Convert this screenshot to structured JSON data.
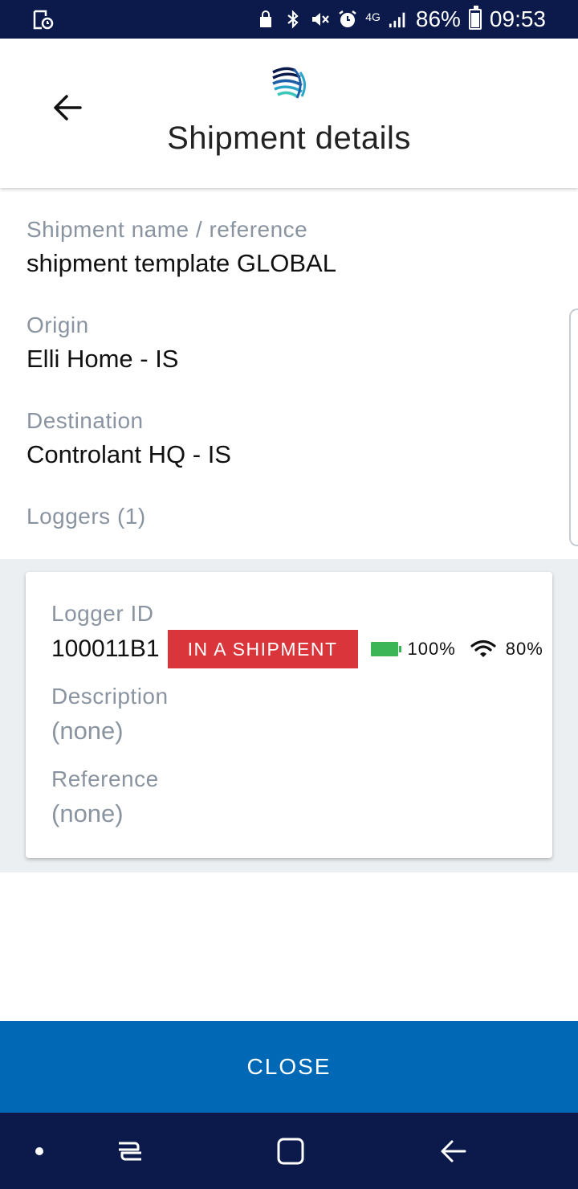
{
  "status_bar": {
    "network": "4G",
    "battery_percent": "86%",
    "time": "09:53"
  },
  "header": {
    "title": "Shipment details"
  },
  "shipment": {
    "name_label": "Shipment name / reference",
    "name_value": "shipment template GLOBAL",
    "origin_label": "Origin",
    "origin_value": "Elli Home - IS",
    "destination_label": "Destination",
    "destination_value": "Controlant HQ - IS",
    "loggers_label": "Loggers (1)"
  },
  "logger": {
    "id_label": "Logger ID",
    "id_value": "100011B1",
    "status": "IN A SHIPMENT",
    "battery": "100%",
    "signal": "80%",
    "description_label": "Description",
    "description_value": "(none)",
    "reference_label": "Reference",
    "reference_value": "(none)"
  },
  "actions": {
    "close_label": "CLOSE"
  },
  "colors": {
    "status_bar_bg": "#0b1a4a",
    "badge_red": "#d9353a",
    "battery_green": "#3cb557",
    "primary_blue": "#0068b4"
  }
}
